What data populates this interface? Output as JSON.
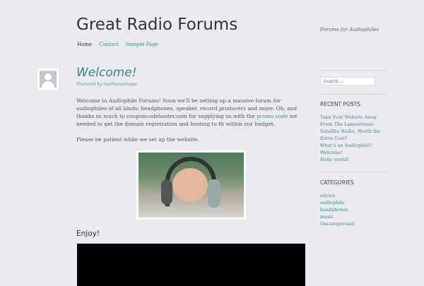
{
  "site": {
    "title": "Great Radio Forums",
    "tagline": "Forums for Audiophiles"
  },
  "nav": [
    {
      "label": "Home"
    },
    {
      "label": "Contact"
    },
    {
      "label": "Sample Page"
    }
  ],
  "post": {
    "title": "Welcome!",
    "byline": "Featured by matthewsimpso",
    "p1_before": "Welcome to Audiophile Forums! Soon we'll be setting up a massive forum for audiophiles of all kinds: headphones, speaker, record producers and more. Oh, and thanks so much to couponcodehoster.com for supplying us with the ",
    "p1_link": "promo code",
    "p1_after": " we needed to get the domain registration and hosting to fit within our budget.",
    "p2": "Please be patient while we set up the website.",
    "subheading": "Enjoy!"
  },
  "sidebar": {
    "search_placeholder": "Search …",
    "recent_title": "RECENT POSTS",
    "recent": [
      "Take Your Website Away From The Lamestream Satellite Radio, Worth the Extra Cost?",
      "What's an Audiophile?",
      "Welcome!",
      "Hello world!"
    ],
    "categories_title": "CATEGORIES",
    "categories": [
      "advice",
      "audiophile",
      "headphones",
      "music",
      "Uncategorized"
    ]
  },
  "colors": {
    "accent": "#3f8c8c",
    "background": "#ebeaef"
  }
}
